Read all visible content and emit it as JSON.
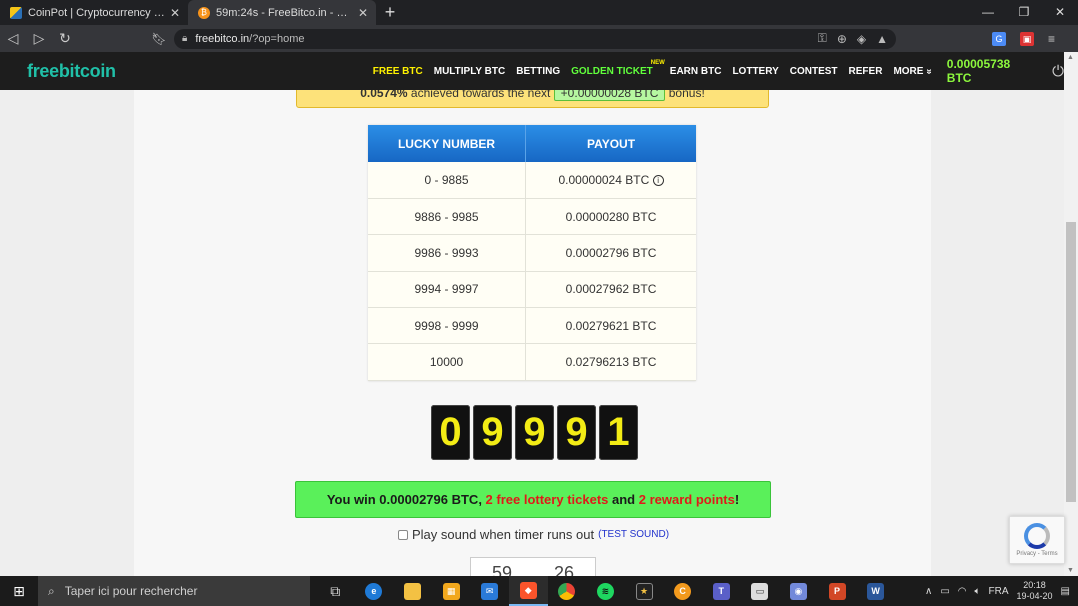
{
  "browser": {
    "tabs": [
      {
        "title": "CoinPot | Cryptocurrency microwa",
        "active": false
      },
      {
        "title": "59m:24s - FreeBitco.in - Win free b",
        "active": true
      }
    ],
    "new_tab": "+",
    "url_host": "freebitco.in",
    "url_path": "/?op=home"
  },
  "site": {
    "logo": "freebitcoin",
    "menu": [
      {
        "label": "FREE BTC",
        "style": "active"
      },
      {
        "label": "MULTIPLY BTC",
        "style": ""
      },
      {
        "label": "BETTING",
        "style": ""
      },
      {
        "label": "GOLDEN TICKET",
        "style": "gold",
        "badge": "NEW"
      },
      {
        "label": "EARN BTC",
        "style": ""
      },
      {
        "label": "LOTTERY",
        "style": ""
      },
      {
        "label": "CONTEST",
        "style": ""
      },
      {
        "label": "REFER",
        "style": ""
      },
      {
        "label": "MORE",
        "style": ""
      }
    ],
    "more_chevron": "»",
    "balance": "0.00005738 BTC"
  },
  "bonus": {
    "percent": "0.0574%",
    "text": " achieved towards the next ",
    "amount": "+0.00000028 BTC",
    "suffix": " bonus!"
  },
  "payout_table": {
    "headers": [
      "LUCKY NUMBER",
      "PAYOUT"
    ],
    "rows": [
      {
        "range": "0 - 9885",
        "payout": "0.00000024 BTC",
        "info": true
      },
      {
        "range": "9886 - 9985",
        "payout": "0.00000280 BTC"
      },
      {
        "range": "9986 - 9993",
        "payout": "0.00002796 BTC"
      },
      {
        "range": "9994 - 9997",
        "payout": "0.00027962 BTC"
      },
      {
        "range": "9998 - 9999",
        "payout": "0.00279621 BTC"
      },
      {
        "range": "10000",
        "payout": "0.02796213 BTC"
      }
    ]
  },
  "roll_digits": [
    "0",
    "9",
    "9",
    "9",
    "1"
  ],
  "win": {
    "prefix": "You win 0.00002796 BTC, ",
    "tickets": "2 free lottery tickets",
    "and": " and ",
    "points": "2 reward points",
    "suffix": "!"
  },
  "sound": {
    "label": "Play sound when timer runs out",
    "test": "(TEST SOUND)"
  },
  "timer": {
    "minutes": "59",
    "seconds": "26"
  },
  "recaptcha": {
    "text": "Privacy - Terms"
  },
  "taskbar": {
    "search_placeholder": "Taper ici pour rechercher",
    "lang": "FRA",
    "time": "20:18",
    "date": "19-04-20"
  }
}
